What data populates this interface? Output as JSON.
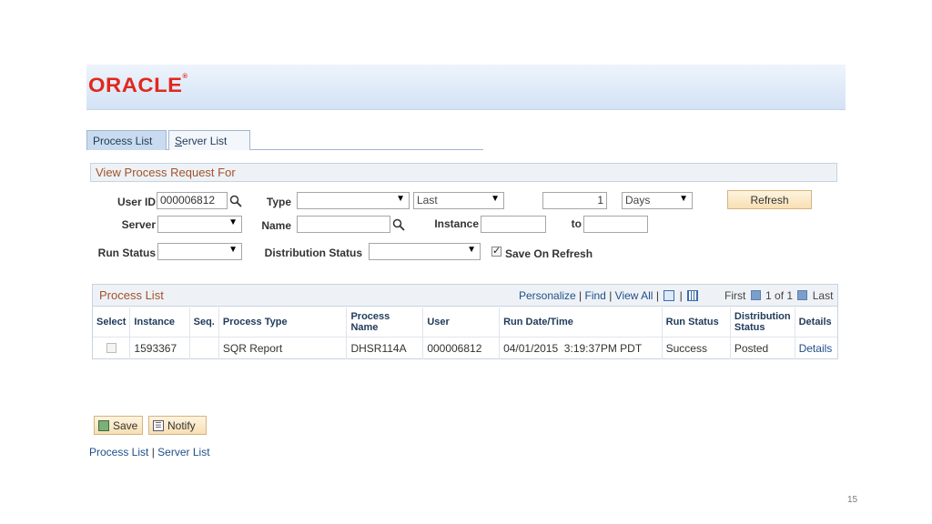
{
  "brand": {
    "logo_text": "ORACLE",
    "logo_mark": "®",
    "logo_color": "#e0281d"
  },
  "tabs": [
    {
      "label": "Process List",
      "active": true
    },
    {
      "label_prefix": "S",
      "label_rest": "erver List",
      "active": false
    }
  ],
  "filter": {
    "title": "View Process Request For",
    "user_id_label": "User ID",
    "user_id_value": "000006812",
    "type_label": "Type",
    "type_value": "",
    "last_value": "Last",
    "days_count": "1",
    "days_unit": "Days",
    "refresh_label": "Refresh",
    "server_label": "Server",
    "server_value": "",
    "name_label": "Name",
    "name_value": "",
    "instance_label": "Instance",
    "instance_from": "",
    "to_label": "to",
    "instance_to": "",
    "run_status_label": "Run Status",
    "run_status_value": "",
    "dist_status_label": "Distribution Status",
    "dist_status_value": "",
    "save_on_refresh_label": "Save On Refresh",
    "save_on_refresh_checked": true
  },
  "process_list": {
    "title": "Process List",
    "personalize": "Personalize",
    "find": "Find",
    "view_all": "View All",
    "first": "First",
    "range": "1 of 1",
    "last": "Last",
    "columns": [
      "Select",
      "Instance",
      "Seq.",
      "Process Type",
      "Process Name",
      "User",
      "Run Date/Time",
      "Run Status",
      "Distribution Status",
      "Details"
    ],
    "rows": [
      {
        "instance": "1593367",
        "seq": "",
        "process_type": "SQR Report",
        "process_name": "DHSR114A",
        "user": "000006812",
        "run_datetime": "04/01/2015  3:19:37PM PDT",
        "run_status": "Success",
        "dist_status": "Posted",
        "details": "Details"
      }
    ]
  },
  "actions": {
    "save_label": "Save",
    "notify_label": "Notify"
  },
  "footer": {
    "process_list_link": "Process List",
    "separator": "|",
    "server_list_link": "Server List"
  },
  "page_number": "15"
}
